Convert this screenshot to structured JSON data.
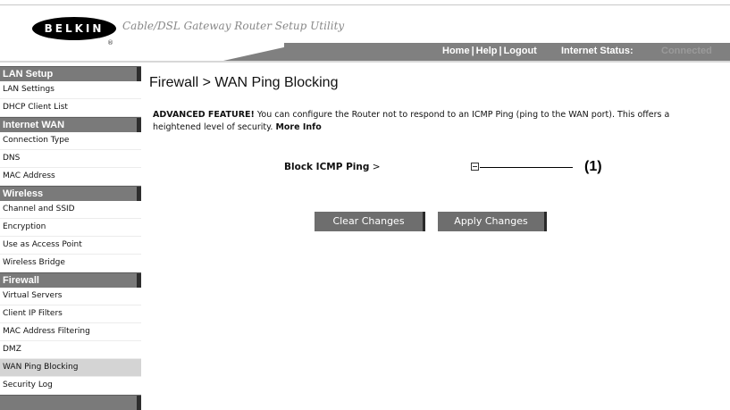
{
  "header": {
    "logo_text": "BELKIN",
    "logo_reg": "®",
    "app_title": "Cable/DSL Gateway Router Setup Utility",
    "links": {
      "home": "Home",
      "help": "Help",
      "logout": "Logout",
      "separator": "|"
    },
    "status_label": "Internet Status:",
    "status_value": "Connected"
  },
  "sidebar": {
    "sections": [
      {
        "title": "LAN Setup",
        "items": [
          "LAN Settings",
          "DHCP Client List"
        ]
      },
      {
        "title": "Internet WAN",
        "items": [
          "Connection Type",
          "DNS",
          "MAC Address"
        ]
      },
      {
        "title": "Wireless",
        "items": [
          "Channel and SSID",
          "Encryption",
          "Use as Access Point",
          "Wireless Bridge"
        ]
      },
      {
        "title": "Firewall",
        "items": [
          "Virtual Servers",
          "Client IP Filters",
          "MAC Address Filtering",
          "DMZ",
          "WAN Ping Blocking",
          "Security Log"
        ]
      }
    ],
    "active_item": "WAN Ping Blocking"
  },
  "main": {
    "title": "Firewall > WAN Ping Blocking",
    "description": {
      "bold_prefix": "ADVANCED FEATURE!",
      "text": " You can configure the Router not to respond to an ICMP Ping (ping to the WAN port). This offers a heightened level of security. ",
      "link": "More Info"
    },
    "field": {
      "label": "Block ICMP Ping",
      "suffix": " >",
      "checked": false
    },
    "callout": "(1)",
    "buttons": {
      "clear": "Clear Changes",
      "apply": "Apply Changes"
    }
  },
  "colors": {
    "header_bar": "#808080",
    "section_header": "#7a7a7a",
    "button": "#6e6e6e",
    "active_item": "#d4d4d4"
  }
}
